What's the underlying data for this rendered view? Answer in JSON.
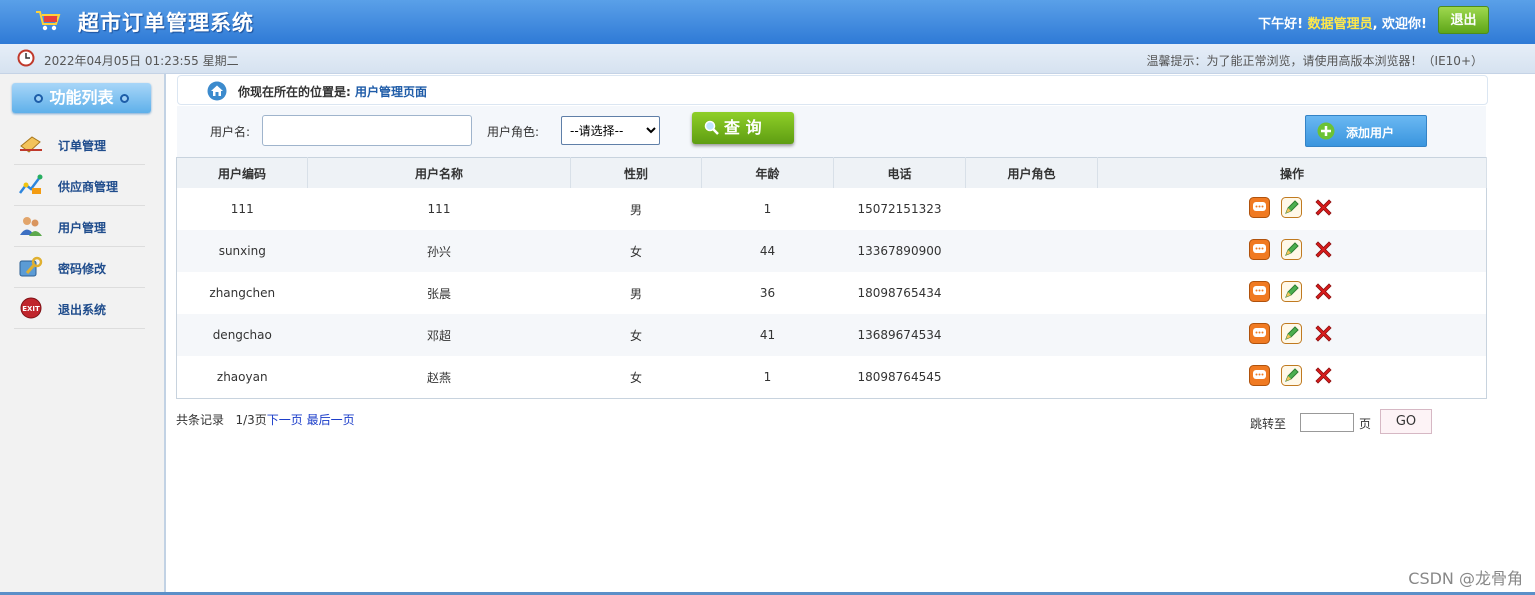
{
  "header": {
    "title": "超市订单管理系统",
    "greeting_prefix": "下午好!",
    "username": "数据管理员",
    "greeting_suffix": ", 欢迎你!",
    "logout_label": "退出",
    "logo_icon": "cart-icon"
  },
  "subbar": {
    "datetime": "2022年04月05日 01:23:55 星期二",
    "tip": "温馨提示：为了能正常浏览，请使用高版本浏览器！（IE10+）",
    "clock_icon": "clock-icon"
  },
  "sidebar": {
    "title": "功能列表",
    "items": [
      {
        "label": "订单管理",
        "icon": "order-icon"
      },
      {
        "label": "供应商管理",
        "icon": "supplier-icon"
      },
      {
        "label": "用户管理",
        "icon": "users-icon"
      },
      {
        "label": "密码修改",
        "icon": "password-icon"
      },
      {
        "label": "退出系统",
        "icon": "exit-icon"
      }
    ]
  },
  "breadcrumb": {
    "prefix": "你现在所在的位置是:",
    "current": "用户管理页面"
  },
  "search": {
    "username_label": "用户名:",
    "username_value": "",
    "role_label": "用户角色:",
    "role_selected": "--请选择--",
    "query_label": "查 询",
    "add_label": "添加用户"
  },
  "table": {
    "columns": [
      "用户编码",
      "用户名称",
      "性别",
      "年龄",
      "电话",
      "用户角色",
      "操作"
    ],
    "rows": [
      {
        "code": "111",
        "name": "111",
        "gender": "男",
        "age": "1",
        "phone": "15072151323",
        "role": ""
      },
      {
        "code": "sunxing",
        "name": "孙兴",
        "gender": "女",
        "age": "44",
        "phone": "13367890900",
        "role": ""
      },
      {
        "code": "zhangchen",
        "name": "张晨",
        "gender": "男",
        "age": "36",
        "phone": "18098765434",
        "role": ""
      },
      {
        "code": "dengchao",
        "name": "邓超",
        "gender": "女",
        "age": "41",
        "phone": "13689674534",
        "role": ""
      },
      {
        "code": "zhaoyan",
        "name": "赵燕",
        "gender": "女",
        "age": "1",
        "phone": "18098764545",
        "role": ""
      }
    ]
  },
  "pagination": {
    "records_label": "共条记录",
    "page_label": "1/3页",
    "next_label": "下一页",
    "last_label": "最后一页",
    "jump_label": "跳转至",
    "page_unit": "页",
    "go_label": "GO"
  },
  "watermark": "CSDN @龙骨角",
  "colors": {
    "header": "#2f7ad6",
    "accent_green": "#5ea619",
    "username": "#ffe84a",
    "link": "#1a3cc9"
  }
}
